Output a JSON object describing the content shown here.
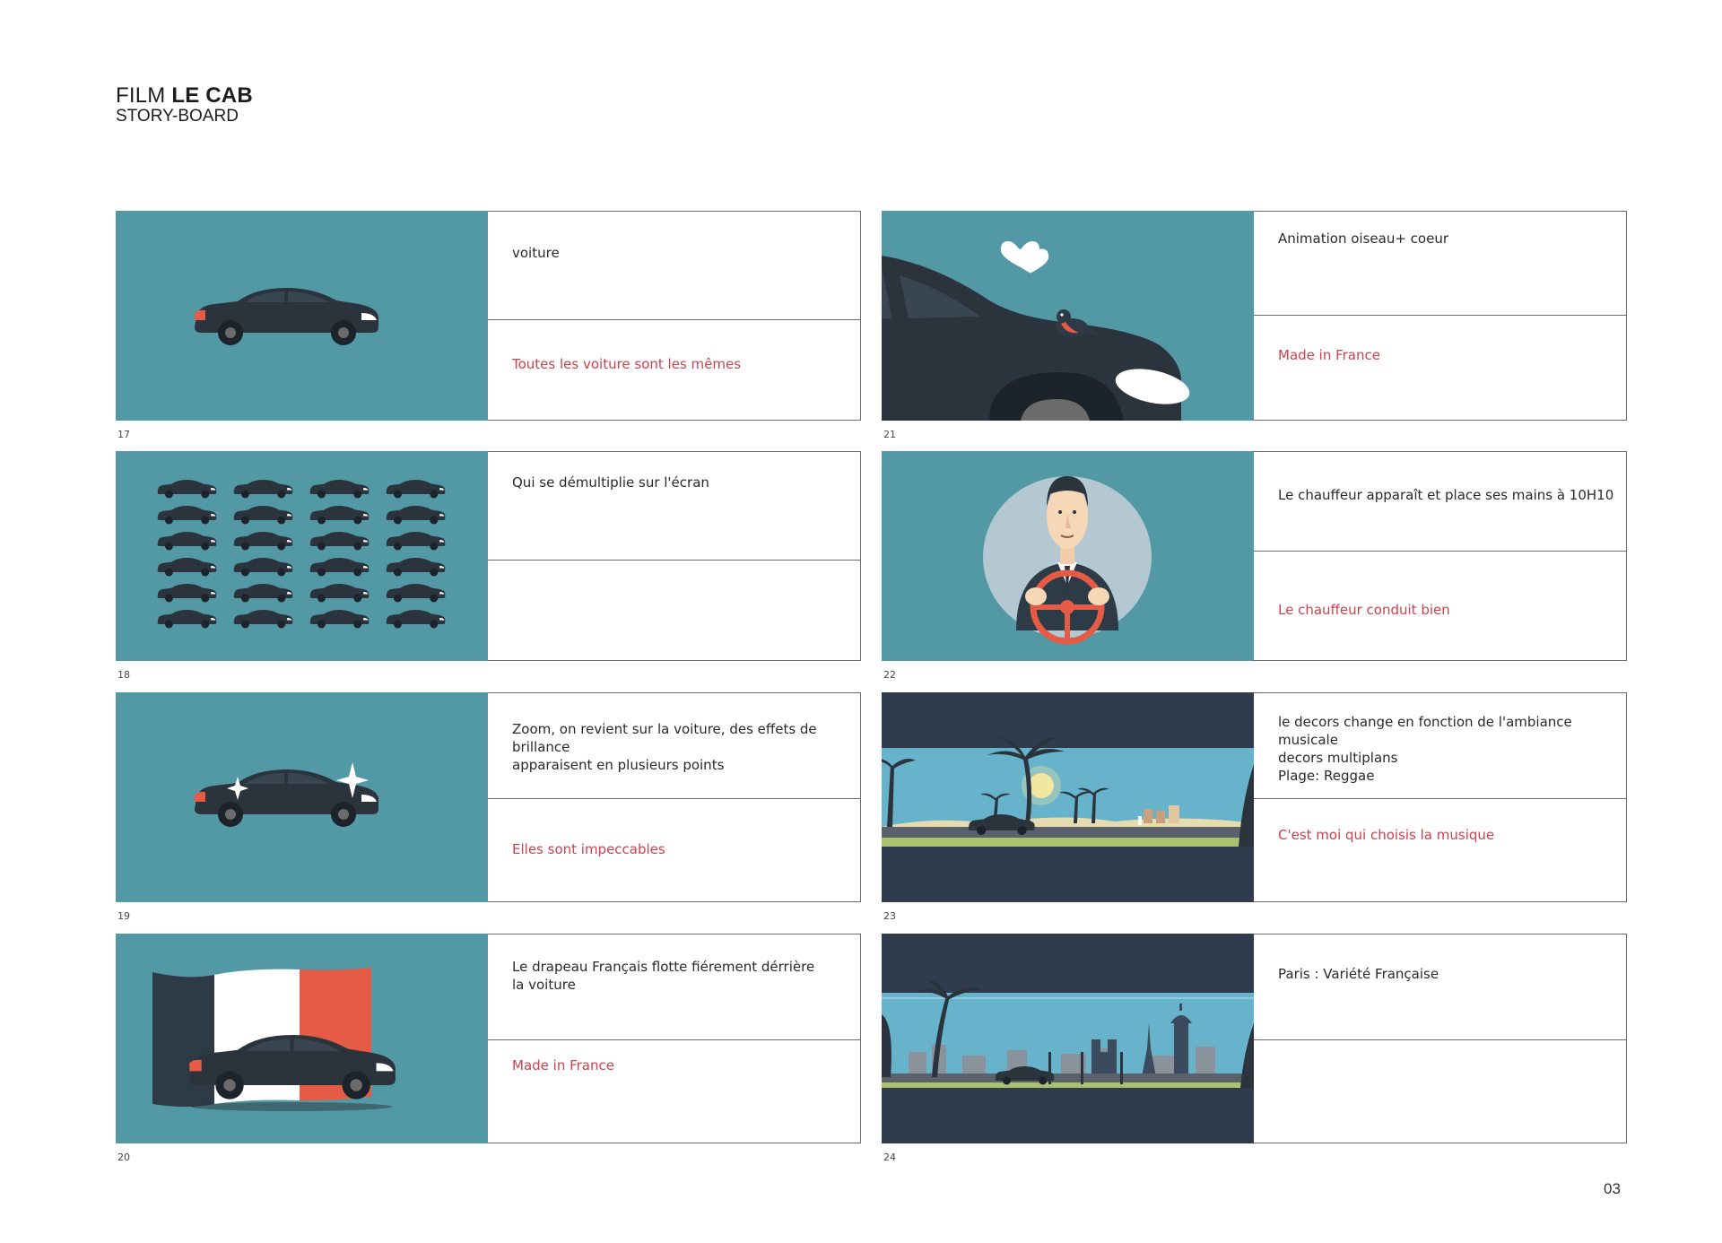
{
  "header": {
    "title_prefix": "FILM",
    "title_bold": "LE CAB",
    "subtitle": "STORY-BOARD"
  },
  "page_number": "03",
  "panels": [
    {
      "number": "17",
      "description": "voiture",
      "voiceover": "Toutes les voiture sont les mêmes"
    },
    {
      "number": "18",
      "description": "Qui se démultiplie sur l'écran",
      "voiceover": ""
    },
    {
      "number": "19",
      "description": "Zoom, on revient sur la voiture,  des effets de brillance\napparaisent en plusieurs points",
      "voiceover": "Elles sont impeccables"
    },
    {
      "number": "20",
      "description": "Le drapeau Français flotte fiérement dérrière\nla voiture",
      "voiceover": "Made in France"
    },
    {
      "number": "21",
      "description": "Animation oiseau+ coeur",
      "voiceover": " Made in France"
    },
    {
      "number": "22",
      "description": "Le chauffeur apparaît et place ses mains à 10H10",
      "voiceover": "Le chauffeur conduit bien"
    },
    {
      "number": "23",
      "description": "le decors change en fonction  de l'ambiance musicale\ndecors multiplans\nPlage: Reggae",
      "voiceover": "C'est moi qui choisis la musique"
    },
    {
      "number": "24",
      "description": "Paris : Variété Française",
      "voiceover": ""
    }
  ],
  "colors": {
    "panel_bg": "#5298a5",
    "car_body": "#2b333d",
    "accent_red": "#c9424e",
    "flag_blue": "#2e3a46",
    "flag_red": "#e55b45",
    "night_band": "#2e3c4e"
  }
}
